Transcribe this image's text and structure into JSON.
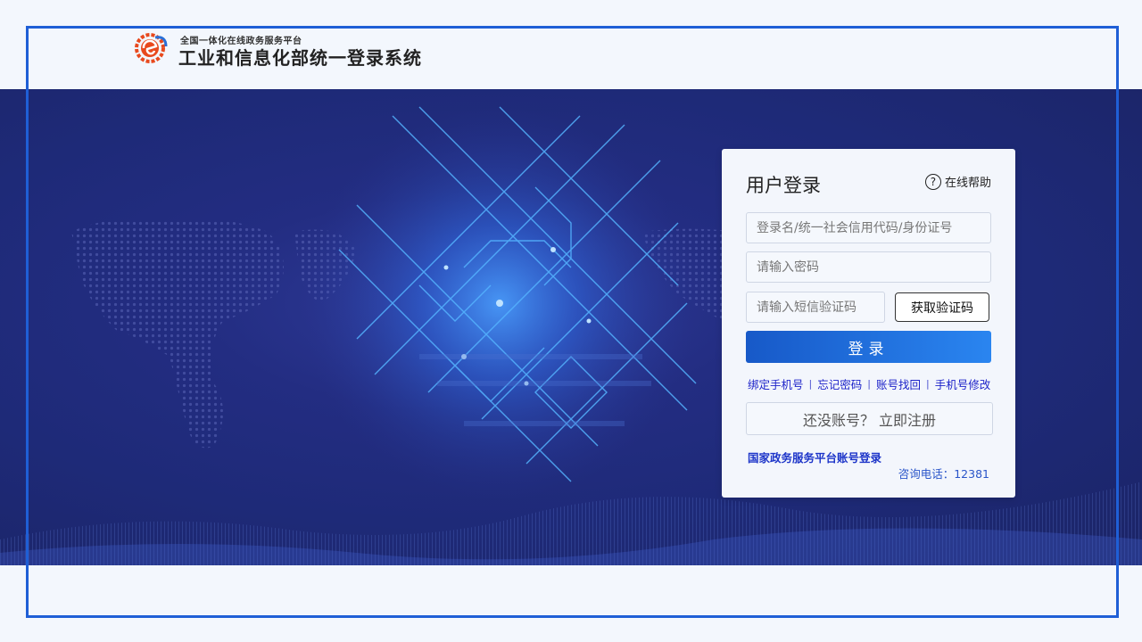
{
  "header": {
    "subtitle": "全国一体化在线政务服务平台",
    "title": "工业和信息化部统一登录系统"
  },
  "login": {
    "title": "用户登录",
    "help_label": "在线帮助",
    "help_icon_glyph": "?",
    "username_placeholder": "登录名/统一社会信用代码/身份证号",
    "password_placeholder": "请输入密码",
    "sms_placeholder": "请输入短信验证码",
    "sms_button": "获取验证码",
    "submit_button": "登录",
    "links": [
      "绑定手机号",
      "忘记密码",
      "账号找回",
      "手机号修改"
    ],
    "register_button": "还没账号？ 立即注册",
    "gov_login_link": "国家政务服务平台账号登录",
    "phone_label": "咨询电话：12381"
  },
  "colors": {
    "frame": "#1f5fd6",
    "link": "#1d23c9",
    "button_start": "#1759c8",
    "button_end": "#2a85f0",
    "hero_bg": "#1e2a78"
  }
}
